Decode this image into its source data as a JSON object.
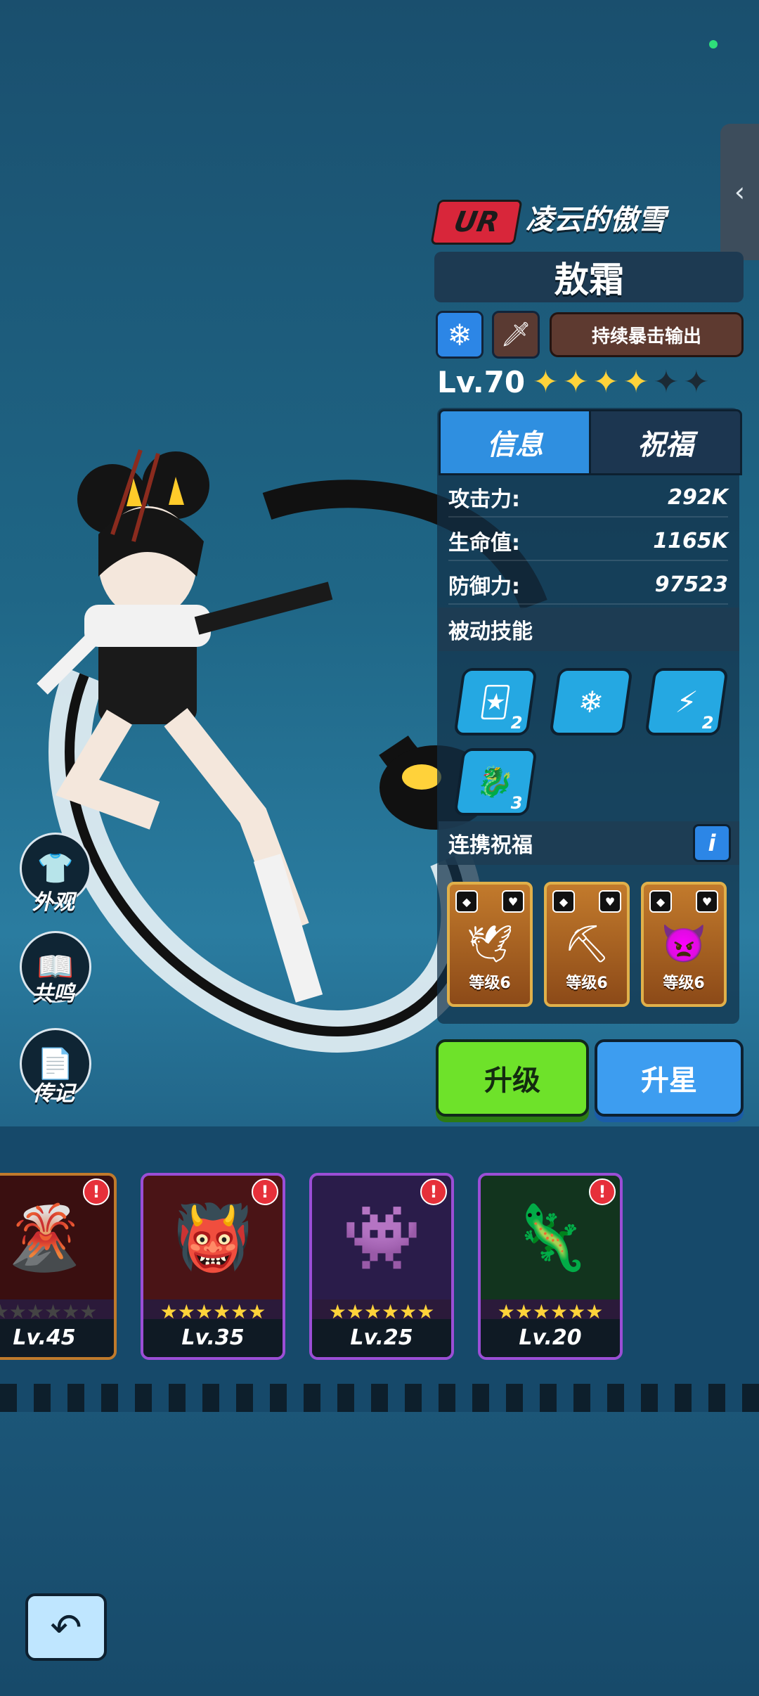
{
  "hero": {
    "rarity": "UR",
    "title": "凌云的傲雪",
    "name": "敖霜",
    "element_icon": "snowflake-icon",
    "role_icon": "sword-icon",
    "trait": "持续暴击输出",
    "level": "Lv.70",
    "stars_filled": 4,
    "stars_total": 6
  },
  "tabs": {
    "info": "信息",
    "blessing": "祝福"
  },
  "stats": [
    {
      "label": "攻击力:",
      "value": "292K"
    },
    {
      "label": "生命值:",
      "value": "1165K"
    },
    {
      "label": "防御力:",
      "value": "97523"
    }
  ],
  "passive": {
    "heading": "被动技能",
    "skills": [
      {
        "icon": "card-dice-icon",
        "count": "2"
      },
      {
        "icon": "snowflake-icon",
        "count": ""
      },
      {
        "icon": "claw-slash-icon",
        "count": "2"
      },
      {
        "icon": "dragon-head-icon",
        "count": "3"
      }
    ]
  },
  "link_blessing": {
    "heading": "连携祝福",
    "info_label": "i",
    "cards": [
      {
        "icon": "bird-icon",
        "level": "等级6"
      },
      {
        "icon": "gold-pickaxe-icon",
        "level": "等级6"
      },
      {
        "icon": "demon-icon",
        "level": "等级6"
      }
    ]
  },
  "buttons": {
    "upgrade": "升级",
    "star_up": "升星"
  },
  "side_menu": {
    "appearance": "外观",
    "resonance": "共鸣",
    "biography": "传记"
  },
  "pets": [
    {
      "icon": "lava-beast-icon",
      "level": "Lv.45",
      "stars": "★★★★★★",
      "stars_filled": 0
    },
    {
      "icon": "red-beast-icon",
      "level": "Lv.35",
      "stars": "★★★★★★",
      "stars_filled": 6
    },
    {
      "icon": "shadow-beast-icon",
      "level": "Lv.25",
      "stars": "★★★★★★",
      "stars_filled": 6
    },
    {
      "icon": "slime-beast-icon",
      "level": "Lv.20",
      "stars": "★★★★★★",
      "stars_filled": 6
    }
  ],
  "alert_mark": "!",
  "colors": {
    "accent_blue": "#2f8fe0",
    "upgrade_green": "#6ee22a",
    "rarity_red": "#d8263a",
    "star_gold": "#ffd33a"
  }
}
